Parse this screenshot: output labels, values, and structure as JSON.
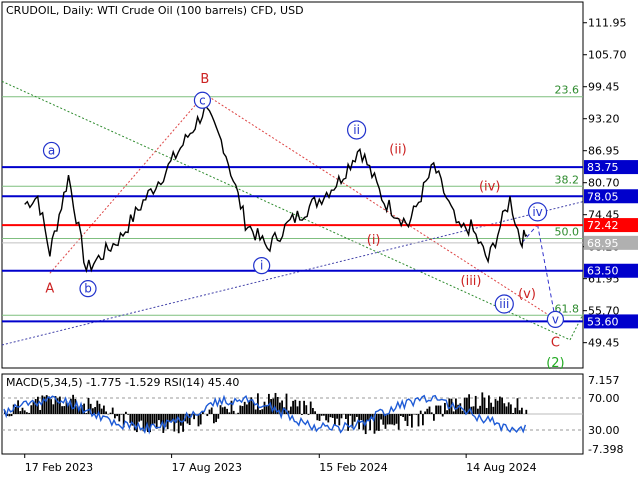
{
  "chart_data": {
    "type": "line",
    "title": "CRUDOIL, Daily:  WTI Crude Oil (100 barrels) CFD, USD",
    "symbol": "CRUDOIL",
    "timeframe": "Daily",
    "instrument": "WTI Crude Oil (100 barrels) CFD",
    "currency": "USD",
    "x_ticks": [
      "17 Feb 2023",
      "17 Aug 2023",
      "15 Feb 2024",
      "14 Aug 2024"
    ],
    "y_ticks": [
      "111.95",
      "105.70",
      "99.45",
      "93.20",
      "86.95",
      "80.70",
      "74.45",
      "68.20",
      "61.95",
      "55.70",
      "49.45"
    ],
    "ylim": [
      44.5,
      116.0
    ],
    "price_series": {
      "x": [
        "2023-02-17",
        "2023-03-05",
        "2023-03-20",
        "2023-04-12",
        "2023-05-04",
        "2023-06-15",
        "2023-07-13",
        "2023-08-10",
        "2023-09-27",
        "2023-10-20",
        "2023-11-16",
        "2023-12-13",
        "2024-01-10",
        "2024-02-15",
        "2024-03-10",
        "2024-04-05",
        "2024-05-05",
        "2024-06-04",
        "2024-07-05",
        "2024-08-05",
        "2024-08-20",
        "2024-09-10",
        "2024-10-07",
        "2024-10-20",
        "2024-10-28"
      ],
      "y": [
        76.5,
        78.0,
        67.0,
        82.0,
        63.7,
        70.0,
        77.0,
        83.0,
        95.0,
        88.0,
        73.0,
        68.0,
        73.0,
        77.5,
        81.0,
        87.5,
        77.0,
        72.5,
        84.0,
        71.5,
        72.0,
        65.5,
        77.5,
        69.5,
        70.5
      ]
    },
    "horizontal_levels": [
      {
        "label": "111.95",
        "value": 111.95,
        "kind": "tick"
      },
      {
        "label": "83.75",
        "value": 83.75,
        "color": "#0000cc",
        "kind": "level"
      },
      {
        "label": "78.05",
        "value": 78.05,
        "color": "#0000cc",
        "kind": "level"
      },
      {
        "label": "72.42",
        "value": 72.42,
        "color": "#ff0000",
        "kind": "level"
      },
      {
        "label": "68.95",
        "value": 68.95,
        "color": "#b0b0b0",
        "kind": "current"
      },
      {
        "label": "63.50",
        "value": 63.5,
        "color": "#0000cc",
        "kind": "level"
      },
      {
        "label": "53.60",
        "value": 53.6,
        "color": "#0000cc",
        "kind": "level"
      }
    ],
    "fibonacci_levels": [
      {
        "label": "23.6",
        "value": 97.5,
        "color": "#2e8b2e"
      },
      {
        "label": "38.2",
        "value": 80.0,
        "color": "#2e8b2e"
      },
      {
        "label": "50.0",
        "value": 69.8,
        "color": "#2e8b2e"
      },
      {
        "label": "61.8",
        "value": 54.8,
        "color": "#2e8b2e"
      }
    ],
    "wave_labels": [
      {
        "text": "A",
        "date": "2023-03-20",
        "value": 60.0,
        "color": "#cc2222",
        "circled": false
      },
      {
        "text": "B",
        "date": "2023-09-27",
        "value": 101.0,
        "color": "#cc2222",
        "circled": false
      },
      {
        "text": "C",
        "date": "2024-12-02",
        "value": 49.5,
        "color": "#cc2222",
        "circled": false
      },
      {
        "text": "a",
        "date": "2023-03-22",
        "value": 87.0,
        "color": "#2233cc",
        "circled": true
      },
      {
        "text": "b",
        "date": "2023-05-06",
        "value": 60.0,
        "color": "#2233cc",
        "circled": true
      },
      {
        "text": "c",
        "date": "2023-09-24",
        "value": 96.8,
        "color": "#2233cc",
        "circled": true
      },
      {
        "text": "i",
        "date": "2023-12-06",
        "value": 64.5,
        "color": "#2233cc",
        "circled": true
      },
      {
        "text": "ii",
        "date": "2024-04-01",
        "value": 91.0,
        "color": "#2233cc",
        "circled": true
      },
      {
        "text": "iii",
        "date": "2024-09-30",
        "value": 57.0,
        "color": "#2233cc",
        "circled": true
      },
      {
        "text": "iv",
        "date": "2024-11-10",
        "value": 75.0,
        "color": "#2233cc",
        "circled": true
      },
      {
        "text": "v",
        "date": "2024-12-02",
        "value": 54.0,
        "color": "#2233cc",
        "circled": true
      },
      {
        "text": "(2)",
        "date": "2024-12-02",
        "value": 45.5,
        "color": "#22aa22",
        "circled": false
      },
      {
        "text": "(i)",
        "date": "2024-04-22",
        "value": 69.5,
        "color": "#cc2222",
        "circled": false
      },
      {
        "text": "(ii)",
        "date": "2024-05-22",
        "value": 87.2,
        "color": "#cc2222",
        "circled": false
      },
      {
        "text": "(iii)",
        "date": "2024-08-20",
        "value": 61.5,
        "color": "#cc2222",
        "circled": false
      },
      {
        "text": "(iv)",
        "date": "2024-09-12",
        "value": 80.0,
        "color": "#cc2222",
        "circled": false
      },
      {
        "text": "(v)",
        "date": "2024-10-28",
        "value": 59.0,
        "color": "#cc2222",
        "circled": false
      }
    ],
    "indicator": {
      "title": "MACD(5,34,5) -1.775 -1.529 RSI(14) 45.40",
      "y_ticks": [
        "7.157",
        "70.00",
        "30.00",
        "-7.398"
      ],
      "ylim": [
        -7.398,
        7.157
      ]
    }
  }
}
